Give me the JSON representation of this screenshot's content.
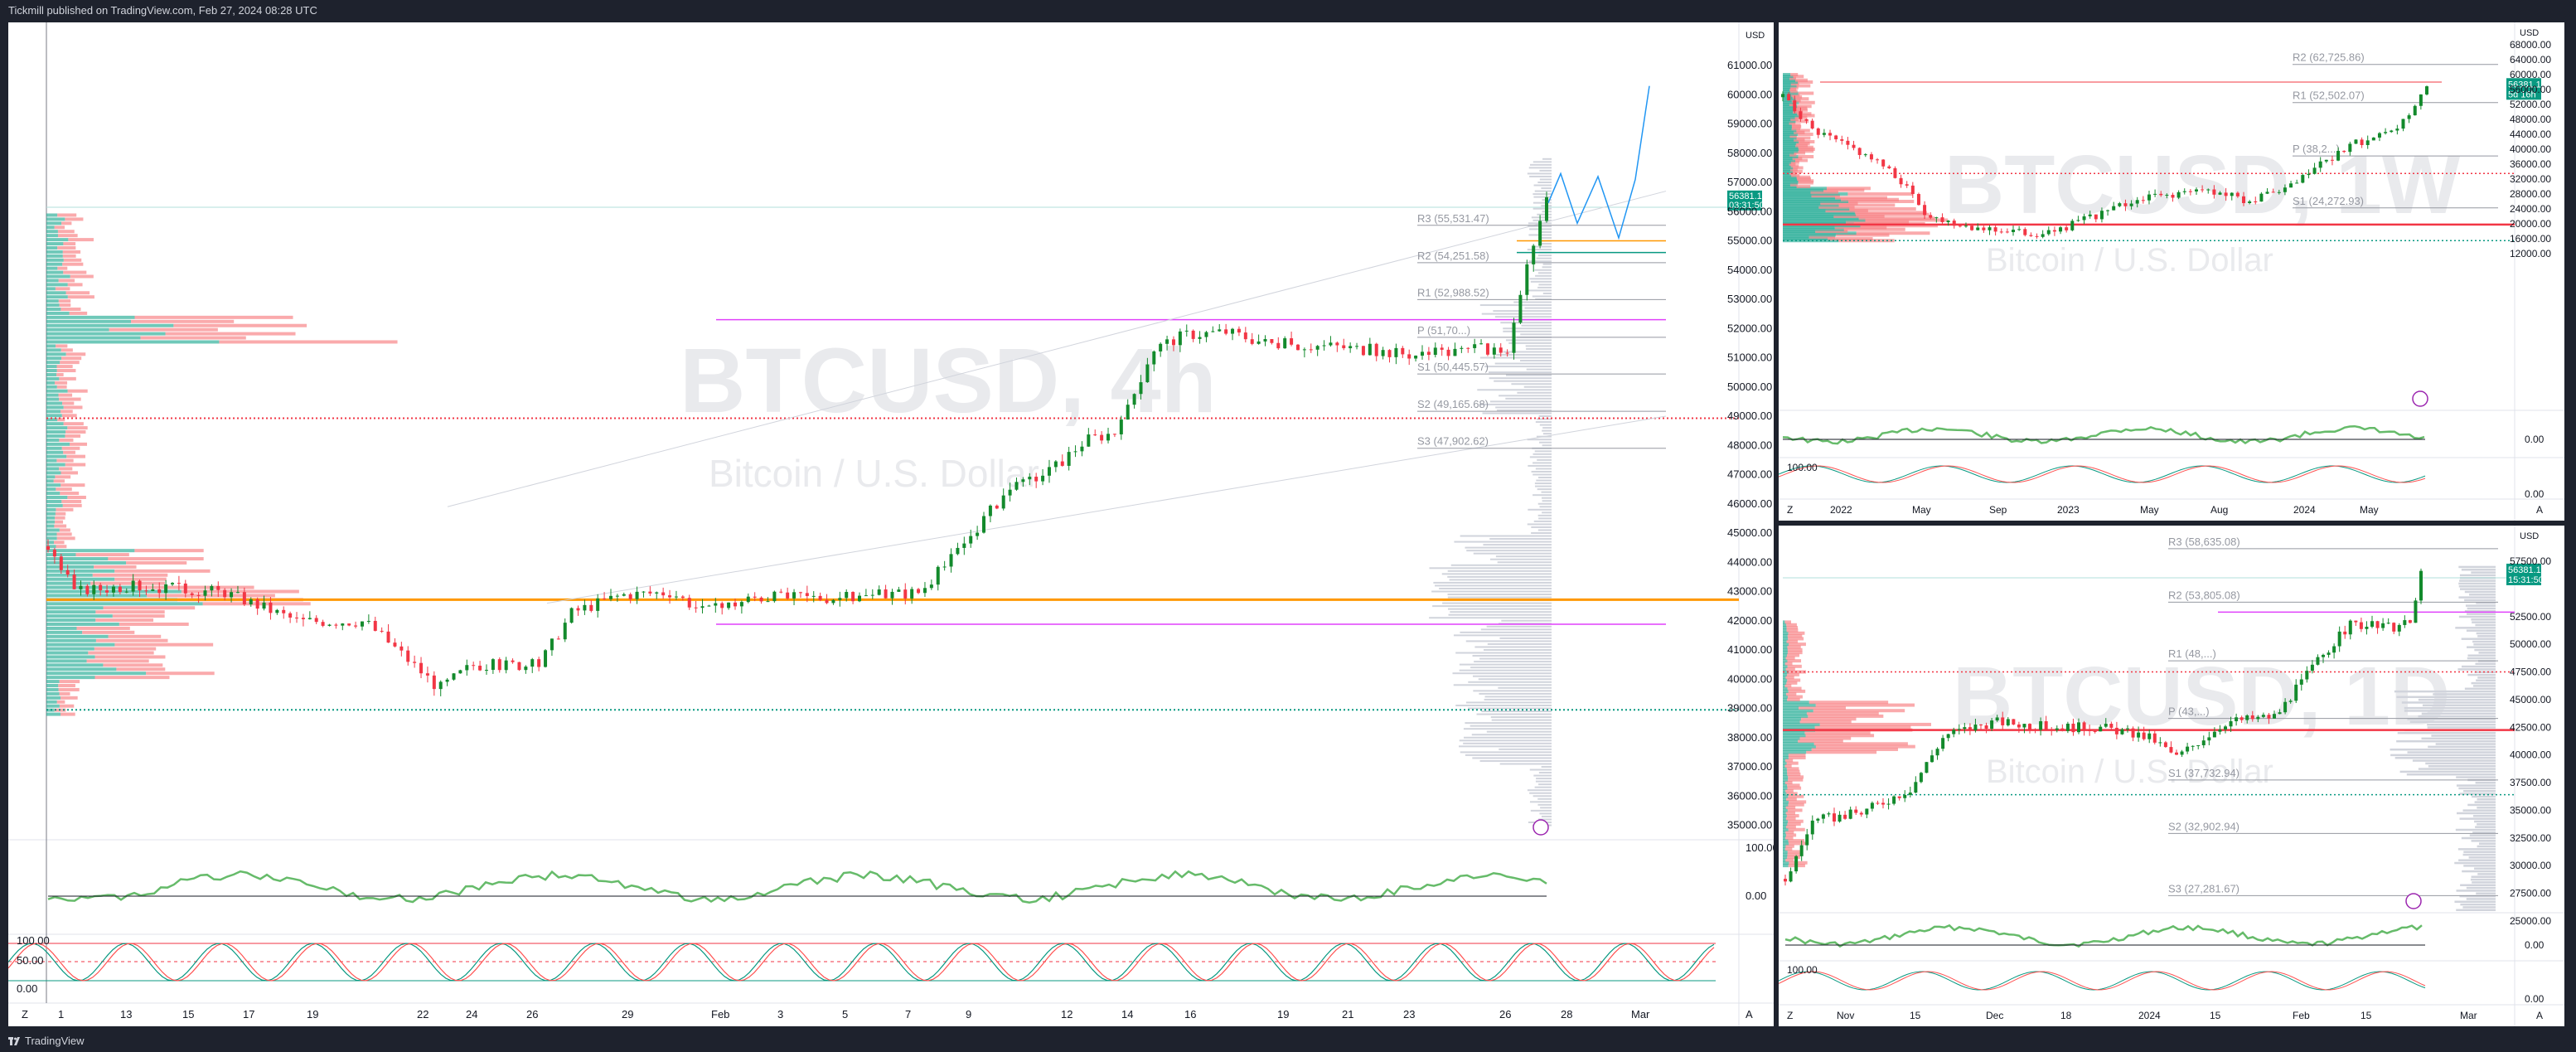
{
  "header": {
    "published": "Tickmill published on TradingView.com, Feb 27, 2024 08:28 UTC"
  },
  "footer": {
    "brand": "TradingView"
  },
  "colors": {
    "up": "#089981",
    "upFill": "#138a2c",
    "down": "#f23645",
    "orange": "#ff9800",
    "magenta": "#e040fb",
    "pivot": "#9598a1",
    "blue": "#2962ff",
    "profileGray": "#d1d4dc"
  },
  "main_chart": {
    "currency": "USD",
    "watermark": "BTCUSD, 4h",
    "subtitle": "Bitcoin / U.S. Dollar",
    "price_ticks": [
      "61000.00",
      "60000.00",
      "59000.00",
      "58000.00",
      "57000.00",
      "56000.00",
      "55000.00",
      "54000.00",
      "53000.00",
      "52000.00",
      "51000.00",
      "50000.00",
      "49000.00",
      "48000.00",
      "47000.00",
      "46000.00",
      "45000.00",
      "44000.00",
      "43000.00",
      "42000.00",
      "41000.00",
      "40000.00",
      "39000.00",
      "38000.00",
      "37000.00",
      "36000.00",
      "35000.00"
    ],
    "last_price": "56381.17",
    "countdown": "03:31:50",
    "pivots": [
      "R3 (55,531.47)",
      "R2 (54,251.58)",
      "R1 (52,988.52)",
      "P (51,70...)",
      "S1 (50,445.57)",
      "S2 (49,165.68)",
      "S3 (47,902.62)"
    ],
    "date_ticks": [
      "1",
      "13",
      "15",
      "17",
      "19",
      "22",
      "24",
      "26",
      "29",
      "Feb",
      "3",
      "5",
      "7",
      "9",
      "12",
      "14",
      "16",
      "19",
      "21",
      "23",
      "26",
      "28",
      "Mar"
    ],
    "osc1_ticks": [
      "100.00",
      "0.00"
    ],
    "osc2_ticks": [
      "100.00",
      "50.00",
      "0.00"
    ],
    "corner_z": "Z",
    "corner_a": "A"
  },
  "weekly_chart": {
    "currency": "USD",
    "watermark": "BTCUSD, 1W",
    "subtitle": "Bitcoin / U.S. Dollar",
    "price_ticks": [
      "68000.00",
      "64000.00",
      "60000.00",
      "56000.00",
      "52000.00",
      "48000.00",
      "44000.00",
      "40000.00",
      "36000.00",
      "32000.00",
      "28000.00",
      "24000.00",
      "20000.00",
      "16000.00",
      "12000.00"
    ],
    "last_price": "56381.17",
    "countdown": "5d 16h",
    "pivots": [
      "R2 (62,725.86)",
      "R1 (52,502.07)",
      "P (38,2...)",
      "S1 (24,272.93)"
    ],
    "date_ticks": [
      "2022",
      "May",
      "Sep",
      "2023",
      "May",
      "Aug",
      "2024",
      "May"
    ],
    "osc1_ticks": [
      "0.00"
    ],
    "osc2_ticks": [
      "100.00",
      "0.00"
    ],
    "corner_z": "Z",
    "corner_a": "A"
  },
  "daily_chart": {
    "currency": "USD",
    "watermark": "BTCUSD, 1D",
    "subtitle": "Bitcoin / U.S. Dollar",
    "price_ticks": [
      "57500.00",
      "52500.00",
      "50000.00",
      "47500.00",
      "45000.00",
      "42500.00",
      "40000.00",
      "37500.00",
      "35000.00",
      "32500.00",
      "30000.00",
      "27500.00",
      "25000.00"
    ],
    "last_price": "56381.17",
    "countdown": "15:31:50",
    "pivots": [
      "R3 (58,635.08)",
      "R2 (53,805.08)",
      "R1 (48,...)",
      "P (43,...)",
      "S1 (37,732.94)",
      "S2 (32,902.94)",
      "S3 (27,281.67)"
    ],
    "date_ticks": [
      "Nov",
      "15",
      "Dec",
      "18",
      "2024",
      "15",
      "Feb",
      "15",
      "Mar"
    ],
    "osc1_ticks": [
      "0.00"
    ],
    "osc2_ticks": [
      "100.00",
      "0.00"
    ],
    "corner_z": "Z",
    "corner_a": "A"
  }
}
